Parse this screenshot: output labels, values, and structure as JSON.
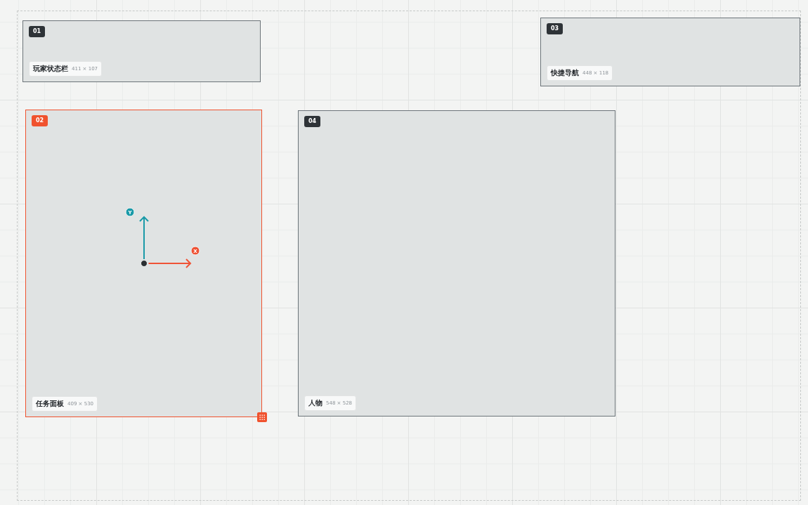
{
  "panels": [
    {
      "number": "01",
      "name": "玩家状态栏",
      "size": "411 × 107",
      "selected": false
    },
    {
      "number": "03",
      "name": "快捷导航",
      "size": "448 × 118",
      "selected": false
    },
    {
      "number": "02",
      "name": "任务面板",
      "size": "409 × 530",
      "selected": true,
      "gizmo": {
        "x_label": "X",
        "y_label": "Y"
      }
    },
    {
      "number": "04",
      "name": "人物",
      "size": "548 × 528",
      "selected": false
    }
  ]
}
